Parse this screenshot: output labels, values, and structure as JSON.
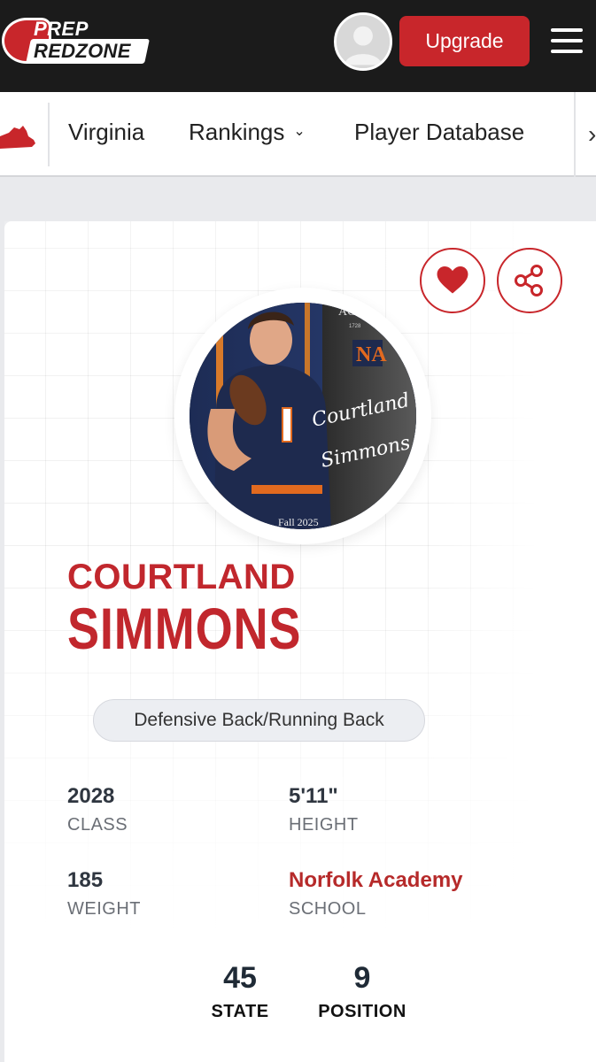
{
  "header": {
    "logo": {
      "line1": "PREP",
      "line2": "REDZONE"
    },
    "upgrade_label": "Upgrade"
  },
  "nav": {
    "items": [
      {
        "label": "Virginia"
      },
      {
        "label": "Rankings"
      },
      {
        "label": "Player Database"
      }
    ],
    "rankings_chevron": "⌄"
  },
  "player": {
    "first_name": "COURTLAND",
    "last_name": "SIMMONS",
    "position": "Defensive Back/Running Back",
    "stats": [
      {
        "value": "2028",
        "label": "CLASS"
      },
      {
        "value": "5'11\"",
        "label": "HEIGHT"
      },
      {
        "value": "185",
        "label": "WEIGHT"
      },
      {
        "value": "Norfolk Academy",
        "label": "SCHOOL"
      }
    ],
    "rankings": [
      {
        "value": "45",
        "label": "STATE"
      },
      {
        "value": "9",
        "label": "POSITION"
      }
    ],
    "photo": {
      "banner_text": "ACA",
      "banner_year": "1728",
      "jersey_number": "1",
      "signature_line1": "Courtland",
      "signature_line2": "Simmons",
      "caption": "Fall 2025"
    }
  },
  "colors": {
    "brand_red": "#c8262b",
    "header_bg": "#1b1b1b",
    "school_link": "#b62a2a"
  },
  "icons": [
    "user-avatar-icon",
    "hamburger-menu-icon",
    "virginia-state-icon",
    "chevron-down-icon",
    "chevron-right-icon",
    "heart-icon",
    "share-icon"
  ]
}
